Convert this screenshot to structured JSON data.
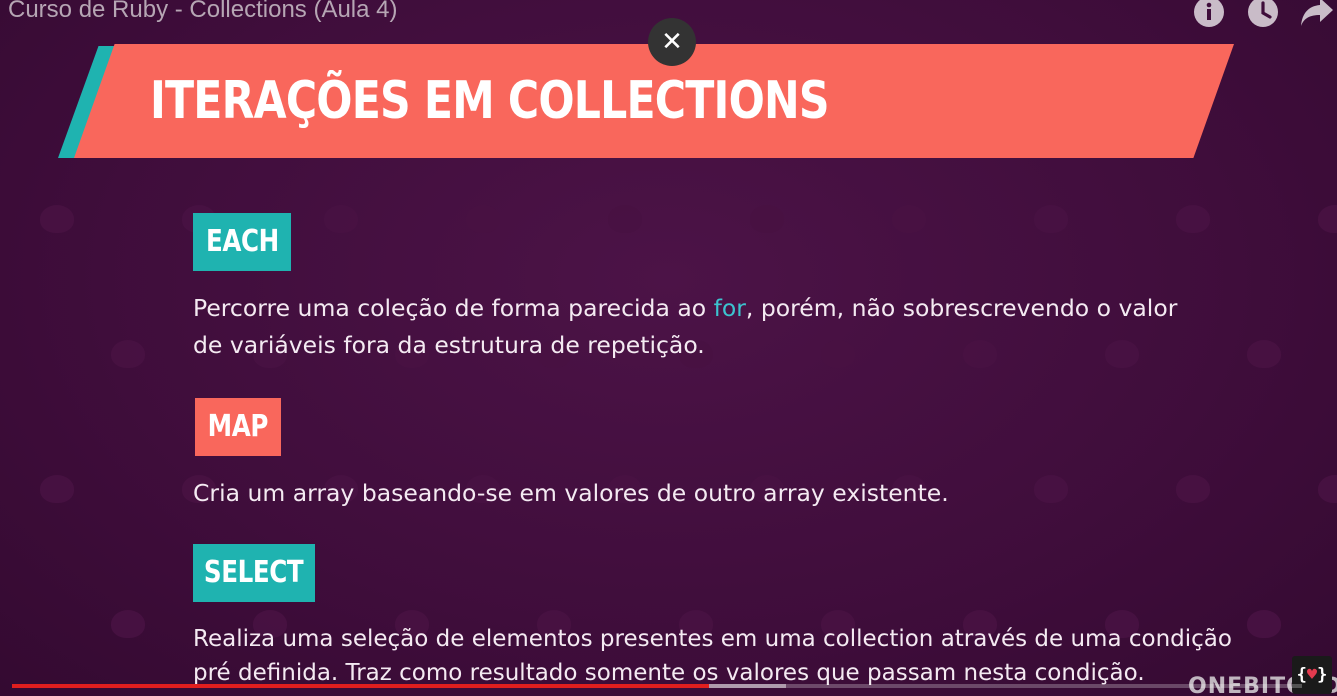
{
  "video": {
    "title": "Curso de Ruby - Collections (Aula 4)",
    "close_symbol": "✕",
    "progress_percent": 54,
    "buffer_percent": 6
  },
  "slide": {
    "title": "ITERAÇÕES EM COLLECTIONS",
    "sections": [
      {
        "tag": "EACH",
        "line1_before": "Percorre uma coleção de forma parecida ao ",
        "line1_keyword": "for",
        "line1_after": ", porém, não sobrescrevendo o valor",
        "line2": "de variáveis fora da estrutura de repetição."
      },
      {
        "tag": "MAP",
        "line1": "Cria um array baseando-se em valores de outro array existente."
      },
      {
        "tag": "SELECT",
        "line1": "Realiza uma seleção de elementos presentes em uma collection através de uma condição",
        "line2": "pré definida. Traz como resultado somente os valores que passam nesta condição."
      }
    ]
  },
  "branding": {
    "watermark": "ONEBITCODE",
    "logo_left": "{",
    "logo_heart": "♥",
    "logo_right": "}"
  },
  "colors": {
    "background": "#3f0d3b",
    "coral": "#f9675c",
    "teal": "#1fb3b0",
    "keyword": "#3cc3cf",
    "progress": "#e01e1e"
  },
  "icons": [
    "info-icon",
    "clock-icon",
    "share-icon",
    "close-icon"
  ]
}
